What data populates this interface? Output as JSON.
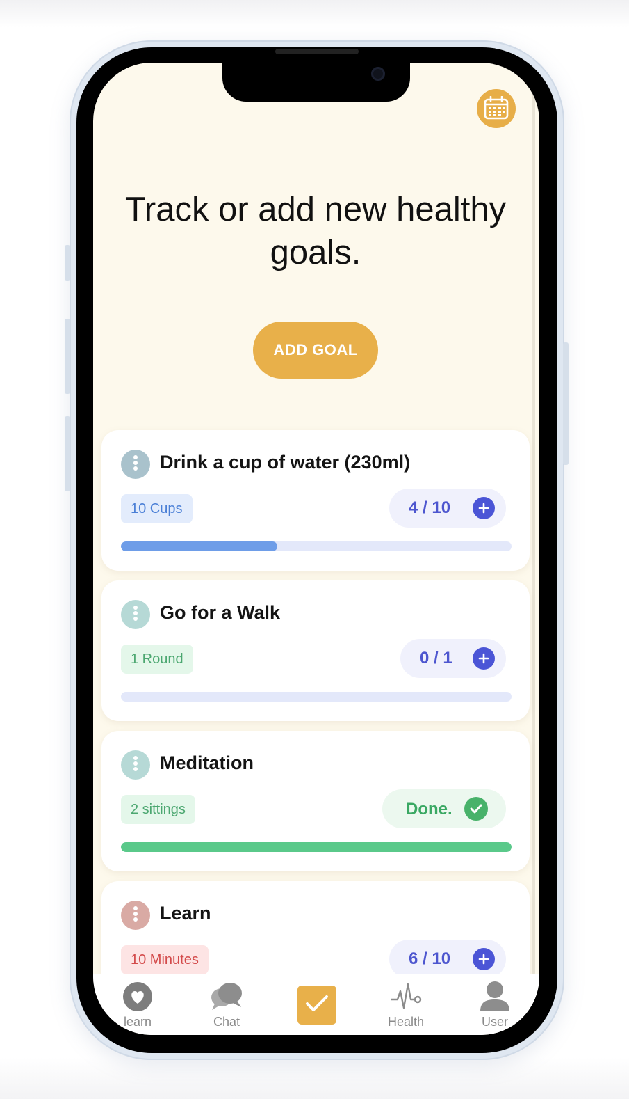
{
  "header": {
    "headline": "Track or add new healthy goals.",
    "add_goal_label": "ADD GOAL",
    "calendar_icon": "calendar-icon"
  },
  "goals": [
    {
      "title": "Drink a cup of water (230ml)",
      "tag": "10 Cups",
      "counter": "4 / 10",
      "progress": 0.4,
      "status": "in-progress",
      "tag_color": "#4a7fd6",
      "tag_bg": "#e3ecfc",
      "menu_color": "#a9c2cc",
      "progress_color": "#6e9de8"
    },
    {
      "title": "Go for a Walk",
      "tag": "1 Round",
      "counter": "0 / 1",
      "progress": 0,
      "status": "in-progress",
      "tag_color": "#4ba770",
      "tag_bg": "#e4f7ea",
      "menu_color": "#b6d9d6",
      "progress_color": "#6e9de8"
    },
    {
      "title": "Meditation",
      "tag": "2 sittings",
      "done_label": "Done.",
      "progress": 1,
      "status": "done",
      "tag_color": "#4ba770",
      "tag_bg": "#e4f7ea",
      "menu_color": "#b6d9d6",
      "progress_color": "#5ac98a"
    },
    {
      "title": "Learn",
      "tag": "10 Minutes",
      "counter": "6 / 10",
      "progress": 0.6,
      "status": "in-progress",
      "tag_color": "#d34a4a",
      "tag_bg": "#fde4e4",
      "menu_color": "#d9aaa4",
      "progress_color": "#6e9de8"
    }
  ],
  "tabbar": {
    "items": [
      {
        "label": "learn",
        "icon": "heart-icon"
      },
      {
        "label": "Chat",
        "icon": "chat-bubbles-icon"
      },
      {
        "label": "",
        "icon": "checkmark-icon",
        "active": true
      },
      {
        "label": "Health",
        "icon": "pulse-icon"
      },
      {
        "label": "User",
        "icon": "user-icon"
      }
    ]
  },
  "colors": {
    "accent": "#e8b04a",
    "screen_bg": "#fdf9ec",
    "counter_text": "#4d56cf",
    "plus_button": "#4b55d6",
    "done_green": "#48b26a"
  }
}
